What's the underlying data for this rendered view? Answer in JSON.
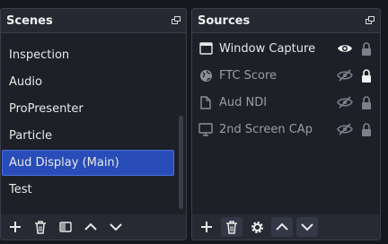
{
  "scenes": {
    "title": "Scenes",
    "items": [
      {
        "label": "Inspection"
      },
      {
        "label": "Audio"
      },
      {
        "label": "ProPresenter"
      },
      {
        "label": "Particle"
      },
      {
        "label": "Aud Display (Main)",
        "selected": true
      },
      {
        "label": "Test"
      }
    ],
    "toolbar": [
      "add-icon",
      "trash-icon",
      "filter-icon",
      "chevron-up-icon",
      "chevron-down-icon"
    ]
  },
  "sources": {
    "title": "Sources",
    "items": [
      {
        "label": "Window Capture",
        "icon": "window-icon",
        "visible": true,
        "locked": false
      },
      {
        "label": "FTC Score",
        "icon": "globe-icon",
        "visible": false,
        "locked": true
      },
      {
        "label": "Aud NDI",
        "icon": "document-icon",
        "visible": false,
        "locked": false
      },
      {
        "label": "2nd Screen CAp",
        "icon": "monitor-icon",
        "visible": false,
        "locked": false
      }
    ],
    "toolbar": [
      "add-icon",
      "trash-icon",
      "gear-icon",
      "chevron-up-icon",
      "chevron-down-icon"
    ]
  },
  "colors": {
    "selection": "#284cb8",
    "panel": "#272a33",
    "list_bg": "#1e2028"
  }
}
